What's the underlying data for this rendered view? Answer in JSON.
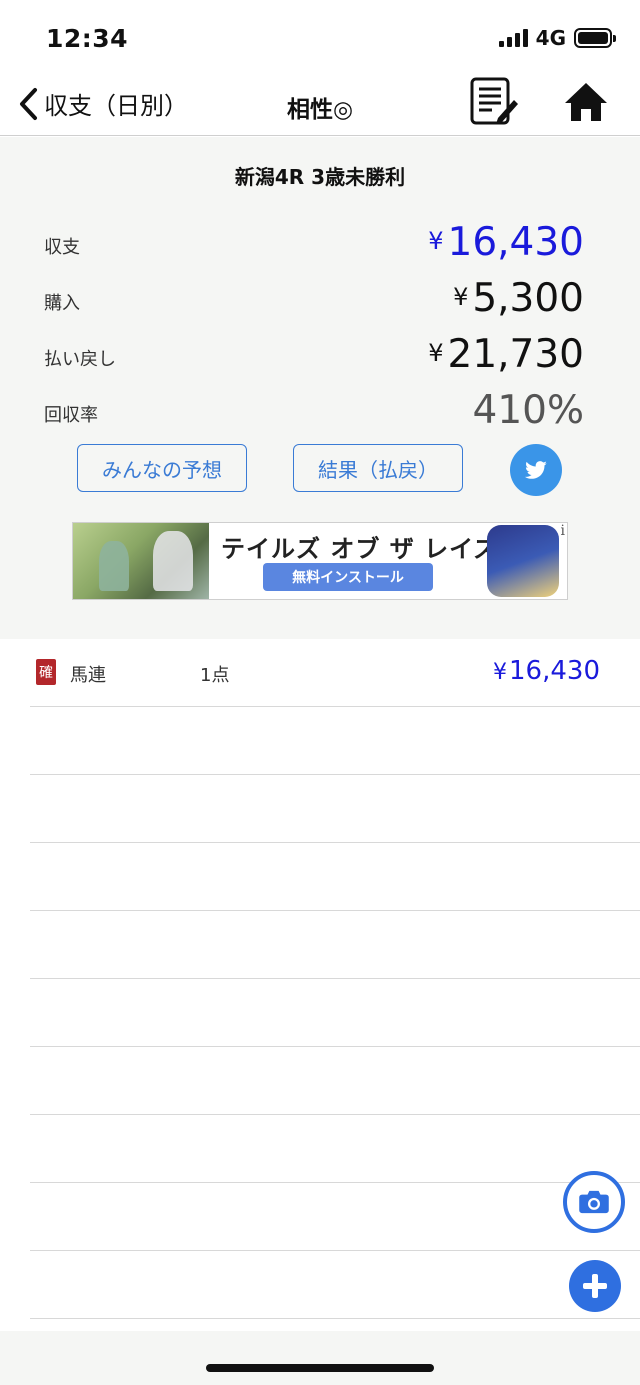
{
  "status_bar": {
    "time": "12:34",
    "network": "4G"
  },
  "nav": {
    "back_label": "収支（日別）",
    "title": "相性◎",
    "icons": [
      "chevron-left-icon",
      "memo-edit-icon",
      "home-icon"
    ]
  },
  "summary": {
    "race_title": "新潟4R  3歳未勝利",
    "rows": [
      {
        "label": "収支",
        "currency": "¥",
        "value": "16,430",
        "color": "#1a1adb"
      },
      {
        "label": "購入",
        "currency": "¥",
        "value": "5,300",
        "color": "#111111"
      },
      {
        "label": "払い戻し",
        "currency": "¥",
        "value": "21,730",
        "color": "#111111"
      },
      {
        "label": "回収率",
        "currency": "",
        "value": "410%",
        "color": "#555555"
      }
    ],
    "buttons": {
      "predictions": "みんなの予想",
      "results": "結果（払戻）"
    },
    "ad": {
      "title": "テイルズ オブ ザ レイズ",
      "cta": "無料インストール",
      "info_mark": "i"
    }
  },
  "bets": [
    {
      "badge": "確",
      "type": "馬連",
      "count": "1点",
      "currency": "¥",
      "amount": "16,430"
    }
  ],
  "colors": {
    "accent_blue": "#2f6fe0",
    "profit_blue": "#1a1adb",
    "twitter_blue": "#3a95e8",
    "badge_red": "#b3272b",
    "panel_bg": "#f5f6f4"
  }
}
